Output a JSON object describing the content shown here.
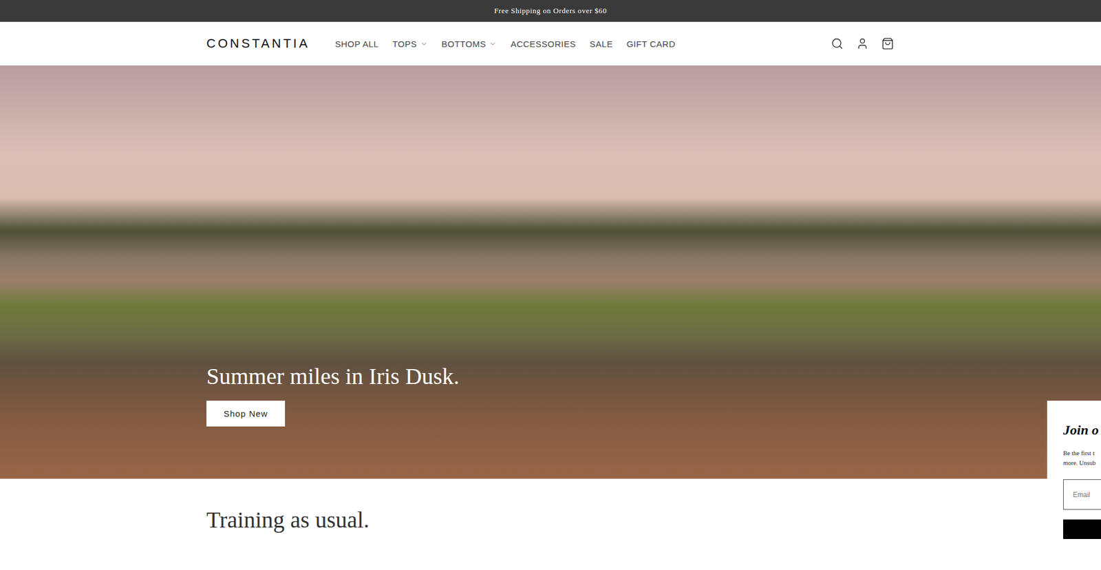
{
  "announcement": "Free Shipping on Orders over $60",
  "header": {
    "logo": "CONSTANTIA",
    "nav": [
      {
        "label": "SHOP ALL",
        "kind": "link"
      },
      {
        "label": "TOPS",
        "kind": "dropdown"
      },
      {
        "label": "BOTTOMS",
        "kind": "dropdown"
      },
      {
        "label": "ACCESSORIES",
        "kind": "link"
      },
      {
        "label": "SALE",
        "kind": "link"
      },
      {
        "label": "GIFT CARD",
        "kind": "link"
      }
    ]
  },
  "hero": {
    "heading": "Summer miles in Iris Dusk.",
    "button": "Shop New"
  },
  "section": {
    "heading": "Training as usual."
  },
  "popup": {
    "title": "Join o",
    "lines": [
      "Be the first t",
      "more. Unsub"
    ],
    "email_placeholder": "Email"
  }
}
